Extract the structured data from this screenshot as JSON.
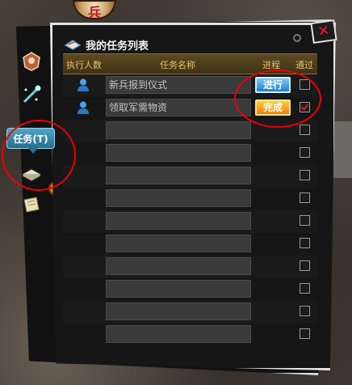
{
  "window": {
    "title": "我的任务列表"
  },
  "tooltip": {
    "label": "任务(T)"
  },
  "table": {
    "headers": {
      "players": "执行人数",
      "name": "任务名称",
      "progress": "进程",
      "passed": "通过"
    },
    "rows": [
      {
        "has_player": true,
        "name": "新兵报到仪式",
        "status": "进行",
        "status_style": "blue",
        "checked": false
      },
      {
        "has_player": true,
        "name": "领取军需物资",
        "status": "完成",
        "status_style": "orange",
        "checked": true
      },
      {
        "has_player": false,
        "name": "",
        "status": "",
        "checked": false
      },
      {
        "has_player": false,
        "name": "",
        "status": "",
        "checked": false
      },
      {
        "has_player": false,
        "name": "",
        "status": "",
        "checked": false
      },
      {
        "has_player": false,
        "name": "",
        "status": "",
        "checked": false
      },
      {
        "has_player": false,
        "name": "",
        "status": "",
        "checked": false
      },
      {
        "has_player": false,
        "name": "",
        "status": "",
        "checked": false
      },
      {
        "has_player": false,
        "name": "",
        "status": "",
        "checked": false
      },
      {
        "has_player": false,
        "name": "",
        "status": "",
        "checked": false
      },
      {
        "has_player": false,
        "name": "",
        "status": "",
        "checked": false
      },
      {
        "has_player": false,
        "name": "",
        "status": "",
        "checked": false
      }
    ]
  },
  "icons": {
    "close": "close-icon",
    "sidebar": [
      "armor-icon",
      "wand-icon",
      "task-book-icon",
      "scroll-icon"
    ]
  },
  "colors": {
    "header_text": "#e8c26a",
    "status_blue": "#1f7fc8",
    "status_orange": "#f27a10",
    "close_red": "#e3192a",
    "annotation_red": "#e00000"
  }
}
